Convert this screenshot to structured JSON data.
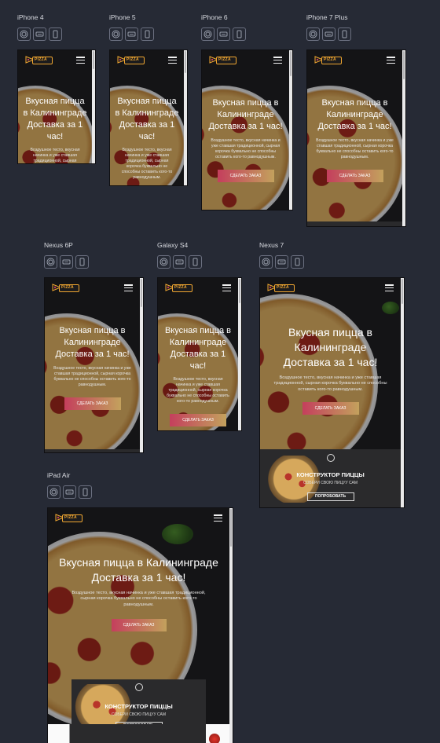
{
  "devices": [
    {
      "id": "iphone4",
      "name": "iPhone 4"
    },
    {
      "id": "iphone5",
      "name": "iPhone 5"
    },
    {
      "id": "iphone6",
      "name": "iPhone 6"
    },
    {
      "id": "iphone7plus",
      "name": "iPhone 7 Plus"
    },
    {
      "id": "nexus6p",
      "name": "Nexus 6P"
    },
    {
      "id": "galaxys4",
      "name": "Galaxy S4"
    },
    {
      "id": "nexus7",
      "name": "Nexus 7"
    },
    {
      "id": "ipadair",
      "name": "iPad Air"
    }
  ],
  "view_icons": [
    "watch-view-icon",
    "landscape-view-icon",
    "portrait-view-icon"
  ],
  "site": {
    "logo_text": "PIZZA",
    "hero_line1": "Вкусная пицца в Калининграде",
    "hero_line2": "Доставка за 1 час!",
    "hero_text": "Воздушное тесто, вкусная начинка и уже ставшая традиционной, сырная корочка буквально не способны оставить кого-то равнодушным.",
    "hero_button": "СДЕЛАТЬ ЗАКАЗ",
    "constructor_title": "КОНСТРУКТОР ПИЦЦЫ",
    "constructor_subtitle": "СОБЕРИ СВОЮ ПИЦУУ САМ",
    "constructor_button": "ПОПРОБОВАТЬ"
  },
  "colors": {
    "background": "#262a35",
    "accent_orange": "#f0a630",
    "button_gradient_start": "#c43f5d",
    "button_gradient_end": "#c3a15d"
  }
}
